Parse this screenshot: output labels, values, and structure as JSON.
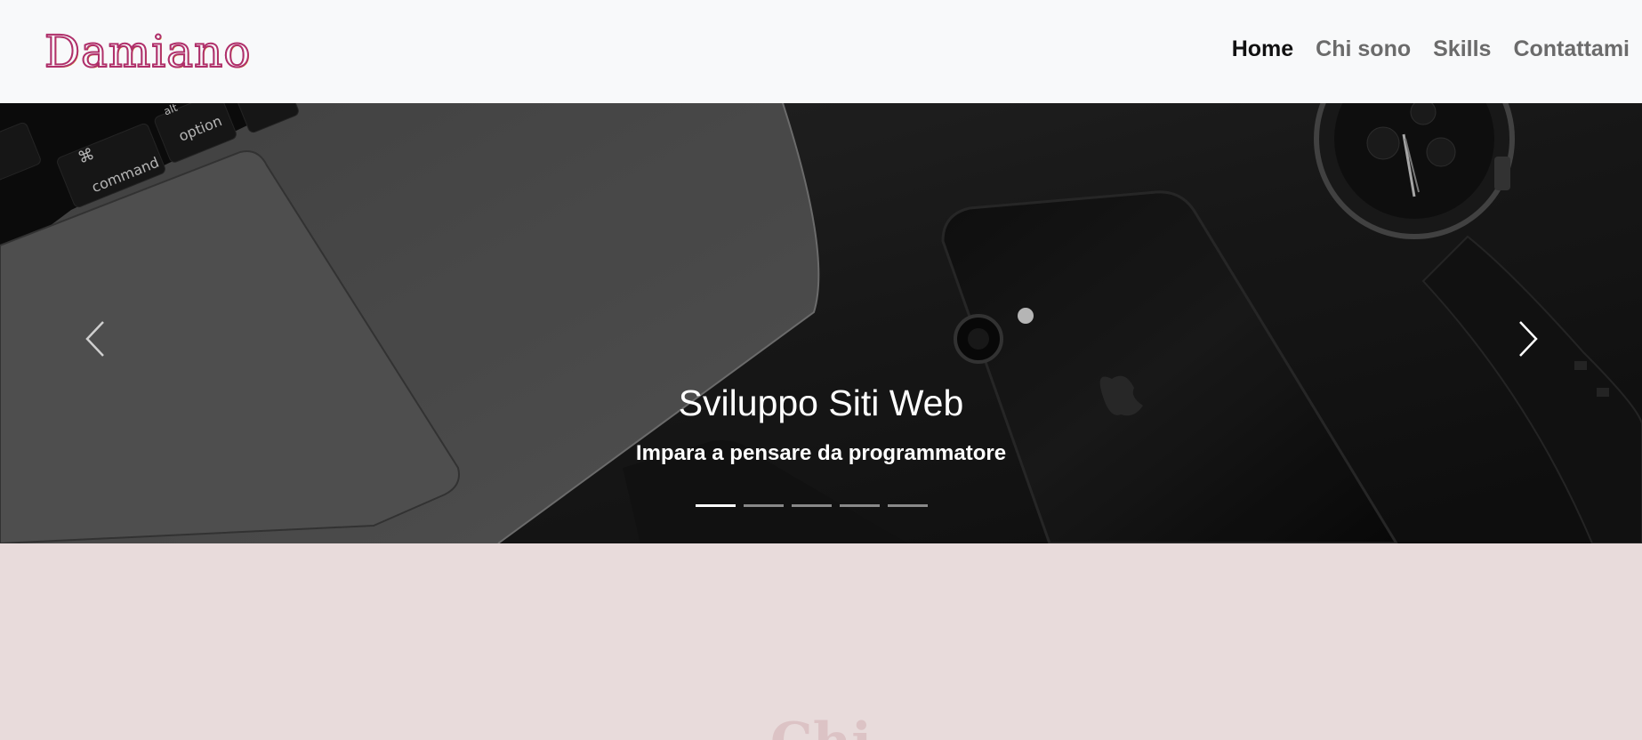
{
  "navbar": {
    "brand": "Damiano",
    "links": [
      {
        "label": "Home",
        "active": true
      },
      {
        "label": "Chi sono",
        "active": false
      },
      {
        "label": "Skills",
        "active": false
      },
      {
        "label": "Contattami",
        "active": false
      }
    ]
  },
  "carousel": {
    "title": "Sviluppo Siti Web",
    "subtitle": "Impara a pensare da programmatore",
    "keyboard_keys": [
      "command",
      "option",
      "alt",
      "⌘"
    ],
    "slide_count": 5,
    "active_slide": 1,
    "prev_icon": "chevron-left-icon",
    "next_icon": "chevron-right-icon"
  },
  "section": {
    "heading": "Chi"
  },
  "colors": {
    "navbar_bg": "#f8f9fa",
    "brand_stroke": "#b0306a",
    "nav_active": "#111111",
    "nav_inactive": "#6b6b6b",
    "section_bg": "#e8dbdb"
  }
}
